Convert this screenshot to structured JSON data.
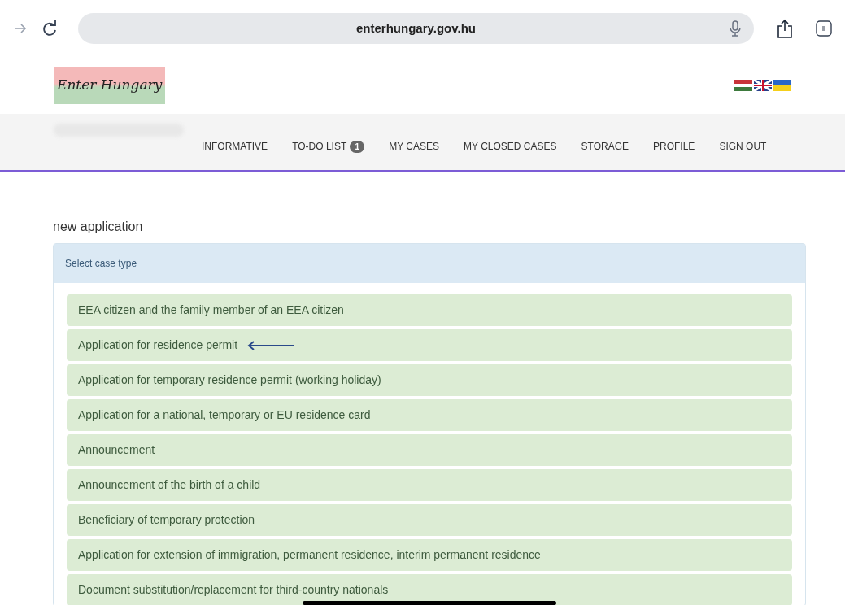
{
  "browser": {
    "url": "enterhungary.gov.hu"
  },
  "header": {
    "logo": "Enter Hungary"
  },
  "nav": {
    "items": [
      {
        "label": "INFORMATIVE"
      },
      {
        "label": "TO-DO LIST",
        "badge": "1"
      },
      {
        "label": "MY CASES"
      },
      {
        "label": "MY CLOSED CASES"
      },
      {
        "label": "STORAGE"
      },
      {
        "label": "PROFILE"
      },
      {
        "label": "SIGN OUT"
      }
    ]
  },
  "page": {
    "title": "new application",
    "panel_title": "Select case type",
    "case_types": [
      {
        "label": "EEA citizen and the family member of an EEA citizen",
        "arrow": false
      },
      {
        "label": "Application for residence permit",
        "arrow": true
      },
      {
        "label": "Application for temporary residence permit (working holiday)",
        "arrow": false
      },
      {
        "label": "Application for a national, temporary or EU residence card",
        "arrow": false
      },
      {
        "label": "Announcement",
        "arrow": false
      },
      {
        "label": "Announcement of the birth of a child",
        "arrow": false
      },
      {
        "label": "Beneficiary of temporary protection",
        "arrow": false
      },
      {
        "label": "Application for extension of immigration, permanent residence, interim permanent residence",
        "arrow": false
      },
      {
        "label": "Document substitution/replacement for third-country nationals",
        "arrow": false
      }
    ]
  }
}
